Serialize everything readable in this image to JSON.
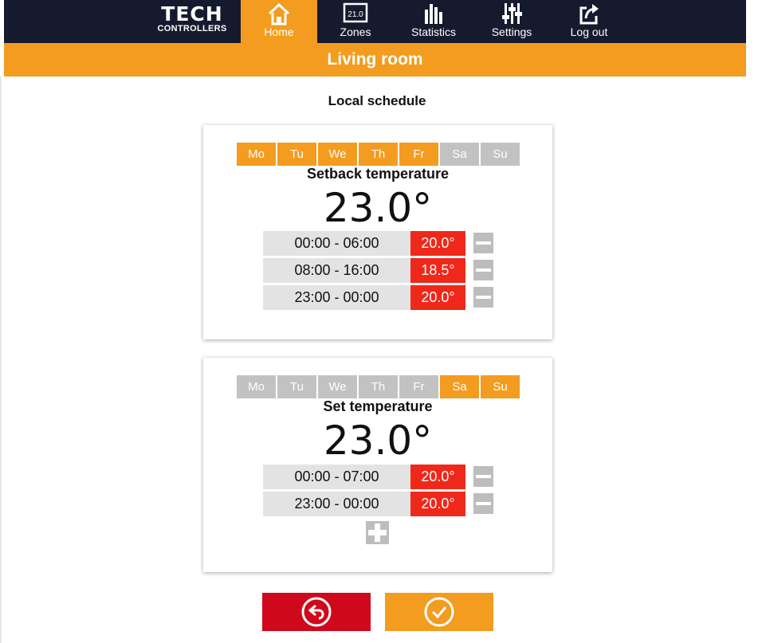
{
  "nav": {
    "logo_brand": "TECH",
    "logo_sub": "CONTROLLERS",
    "items": [
      {
        "label": "Home",
        "icon": "home-icon",
        "active": true
      },
      {
        "label": "Zones",
        "icon": "zones-thermostat-icon",
        "icon_text": "21.0",
        "active": false
      },
      {
        "label": "Statistics",
        "icon": "statistics-icon",
        "active": false
      },
      {
        "label": "Settings",
        "icon": "settings-sliders-icon",
        "active": false
      },
      {
        "label": "Log out",
        "icon": "logout-icon",
        "active": false
      }
    ]
  },
  "header": {
    "title": "Living room"
  },
  "page": {
    "subtitle": "Local schedule"
  },
  "colors": {
    "accent": "#f39c1f",
    "nav_bg": "#161a2e",
    "temp_badge": "#f0281a",
    "back": "#d0081c",
    "day_off": "#c2c2c2"
  },
  "schedules": [
    {
      "days": [
        {
          "label": "Mo",
          "on": true
        },
        {
          "label": "Tu",
          "on": true
        },
        {
          "label": "We",
          "on": true
        },
        {
          "label": "Th",
          "on": true
        },
        {
          "label": "Fr",
          "on": true
        },
        {
          "label": "Sa",
          "on": false
        },
        {
          "label": "Su",
          "on": false
        }
      ],
      "mode_label": "Setback temperature",
      "temperature": "23.0°",
      "intervals": [
        {
          "time": "00:00  -  06:00",
          "temp": "20.0°"
        },
        {
          "time": "08:00  -  16:00",
          "temp": "18.5°"
        },
        {
          "time": "23:00  -  00:00",
          "temp": "20.0°"
        }
      ]
    },
    {
      "days": [
        {
          "label": "Mo",
          "on": false
        },
        {
          "label": "Tu",
          "on": false
        },
        {
          "label": "We",
          "on": false
        },
        {
          "label": "Th",
          "on": false
        },
        {
          "label": "Fr",
          "on": false
        },
        {
          "label": "Sa",
          "on": true
        },
        {
          "label": "Su",
          "on": true
        }
      ],
      "mode_label": "Set temperature",
      "temperature": "23.0°",
      "intervals": [
        {
          "time": "00:00  -  07:00",
          "temp": "20.0°"
        },
        {
          "time": "23:00  -  00:00",
          "temp": "20.0°"
        }
      ]
    }
  ],
  "actions": {
    "back_icon": "undo-arrow-icon",
    "confirm_icon": "check-circle-icon"
  }
}
